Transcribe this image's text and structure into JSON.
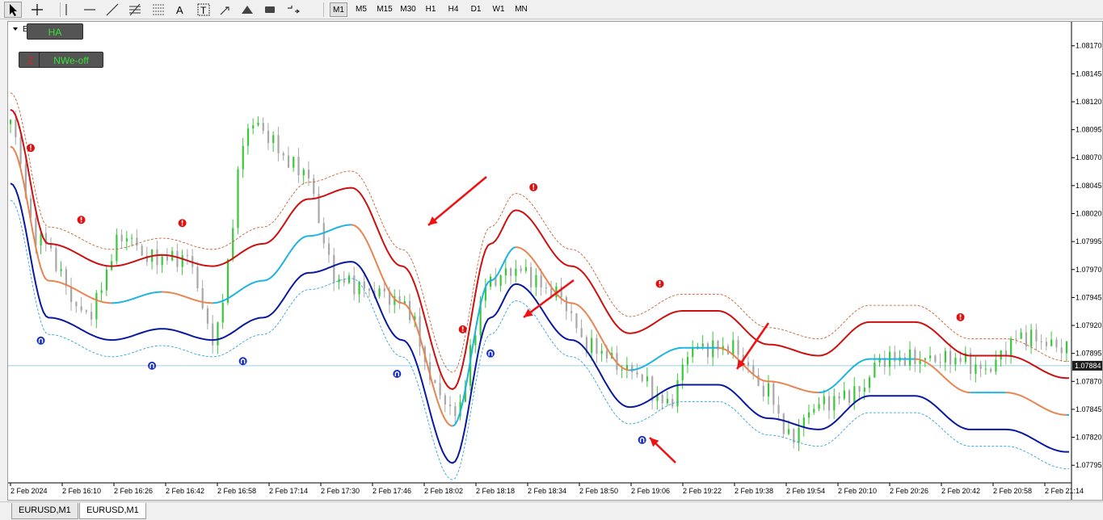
{
  "toolbar": {
    "tools": [
      "cursor-icon",
      "crosshair-icon",
      "vertical-line-icon",
      "horizontal-line-icon",
      "trendline-icon",
      "fibonacci-icon",
      "fibo-grid-icon",
      "text-icon",
      "text-label-icon",
      "arrow-tool-icon",
      "triangle-icon",
      "rectangle-icon",
      "arrows-menu-icon"
    ],
    "tool_glyphs": {
      "text-icon": "A",
      "text-label-icon": "T"
    },
    "timeframes": [
      "M1",
      "M5",
      "M15",
      "M30",
      "H1",
      "H4",
      "D1",
      "W1",
      "MN"
    ],
    "active_timeframe": "M1"
  },
  "chart": {
    "symbol_label": "EURUSD,M1",
    "buttons": {
      "ha": "HA",
      "nwe": "NWe-off",
      "z": "Z"
    },
    "current_price": "1.07884",
    "colors": {
      "upper_band": "#cc1010",
      "upper_dash": "#c0501c",
      "mid_upper": "#e8834e",
      "mid_lower": "#1ab2e0",
      "lower_band": "#0a1aa0",
      "lower_dash": "#1a9ad8",
      "bull": "#38c838",
      "bear": "#a8a8a8",
      "sell_signal": "#dd1111",
      "buy_signal": "#1830c0",
      "arrow": "#ee1111"
    }
  },
  "chart_data": {
    "type": "candlestick",
    "symbol": "EURUSD,M1",
    "y_ticks": [
      "1.08170",
      "1.08145",
      "1.08120",
      "1.08095",
      "1.08070",
      "1.08045",
      "1.08020",
      "1.07995",
      "1.07970",
      "1.07945",
      "1.07920",
      "1.07895",
      "1.07870",
      "1.07845",
      "1.07820",
      "1.07795"
    ],
    "ylim": [
      1.0778,
      1.0819
    ],
    "x_ticks": [
      "2 Feb 2024",
      "2 Feb 16:10",
      "2 Feb 16:26",
      "2 Feb 16:42",
      "2 Feb 16:58",
      "2 Feb 17:14",
      "2 Feb 17:30",
      "2 Feb 17:46",
      "2 Feb 18:02",
      "2 Feb 18:18",
      "2 Feb 18:34",
      "2 Feb 18:50",
      "2 Feb 19:06",
      "2 Feb 19:22",
      "2 Feb 19:38",
      "2 Feb 19:54",
      "2 Feb 20:10",
      "2 Feb 20:26",
      "2 Feb 20:42",
      "2 Feb 20:58",
      "2 Feb 21:14"
    ],
    "current_price": 1.07884,
    "middle_band": [
      [
        0,
        1.0808
      ],
      [
        15,
        1.0796
      ],
      [
        40,
        1.0794
      ],
      [
        60,
        1.0795
      ],
      [
        80,
        1.0794
      ],
      [
        100,
        1.0796
      ],
      [
        118,
        1.08
      ],
      [
        135,
        1.0801
      ],
      [
        155,
        1.0794
      ],
      [
        175,
        1.0783
      ],
      [
        190,
        1.0796
      ],
      [
        200,
        1.0799
      ],
      [
        222,
        1.0794
      ],
      [
        245,
        1.0788
      ],
      [
        266,
        1.079
      ],
      [
        280,
        1.079
      ],
      [
        300,
        1.0787
      ],
      [
        320,
        1.0786
      ],
      [
        340,
        1.0789
      ],
      [
        358,
        1.0789
      ],
      [
        380,
        1.0786
      ],
      [
        394,
        1.0786
      ],
      [
        418,
        1.0784
      ]
    ],
    "candle_close_path": [
      [
        0,
        1.081
      ],
      [
        10,
        1.08
      ],
      [
        30,
        1.0793
      ],
      [
        45,
        1.08
      ],
      [
        55,
        1.0798
      ],
      [
        70,
        1.0798
      ],
      [
        80,
        1.0791
      ],
      [
        95,
        1.081
      ],
      [
        115,
        1.0806
      ],
      [
        130,
        1.0796
      ],
      [
        145,
        1.0795
      ],
      [
        155,
        1.0794
      ],
      [
        170,
        1.0786
      ],
      [
        175,
        1.0784
      ],
      [
        190,
        1.0796
      ],
      [
        200,
        1.0797
      ],
      [
        215,
        1.0795
      ],
      [
        230,
        1.079
      ],
      [
        245,
        1.0788
      ],
      [
        260,
        1.0785
      ],
      [
        270,
        1.079
      ],
      [
        285,
        1.079
      ],
      [
        300,
        1.0786
      ],
      [
        308,
        1.0782
      ],
      [
        320,
        1.0785
      ],
      [
        335,
        1.0786
      ],
      [
        345,
        1.0789
      ],
      [
        360,
        1.0789
      ],
      [
        375,
        1.0789
      ],
      [
        385,
        1.0788
      ],
      [
        400,
        1.0791
      ],
      [
        418,
        1.079
      ]
    ],
    "signals": [
      {
        "type": "sell",
        "i": 8
      },
      {
        "type": "sell",
        "i": 28
      },
      {
        "type": "sell",
        "i": 68
      },
      {
        "type": "sell",
        "i": 179
      },
      {
        "type": "sell",
        "i": 207
      },
      {
        "type": "sell",
        "i": 257
      },
      {
        "type": "sell",
        "i": 376
      },
      {
        "type": "buy",
        "i": 12
      },
      {
        "type": "buy",
        "i": 56
      },
      {
        "type": "buy",
        "i": 92
      },
      {
        "type": "buy",
        "i": 153
      },
      {
        "type": "buy",
        "i": 190
      },
      {
        "type": "buy",
        "i": 250
      }
    ]
  },
  "tabs": [
    {
      "label": "EURUSD,M1",
      "active": false
    },
    {
      "label": "EURUSD,M1",
      "active": true
    }
  ]
}
